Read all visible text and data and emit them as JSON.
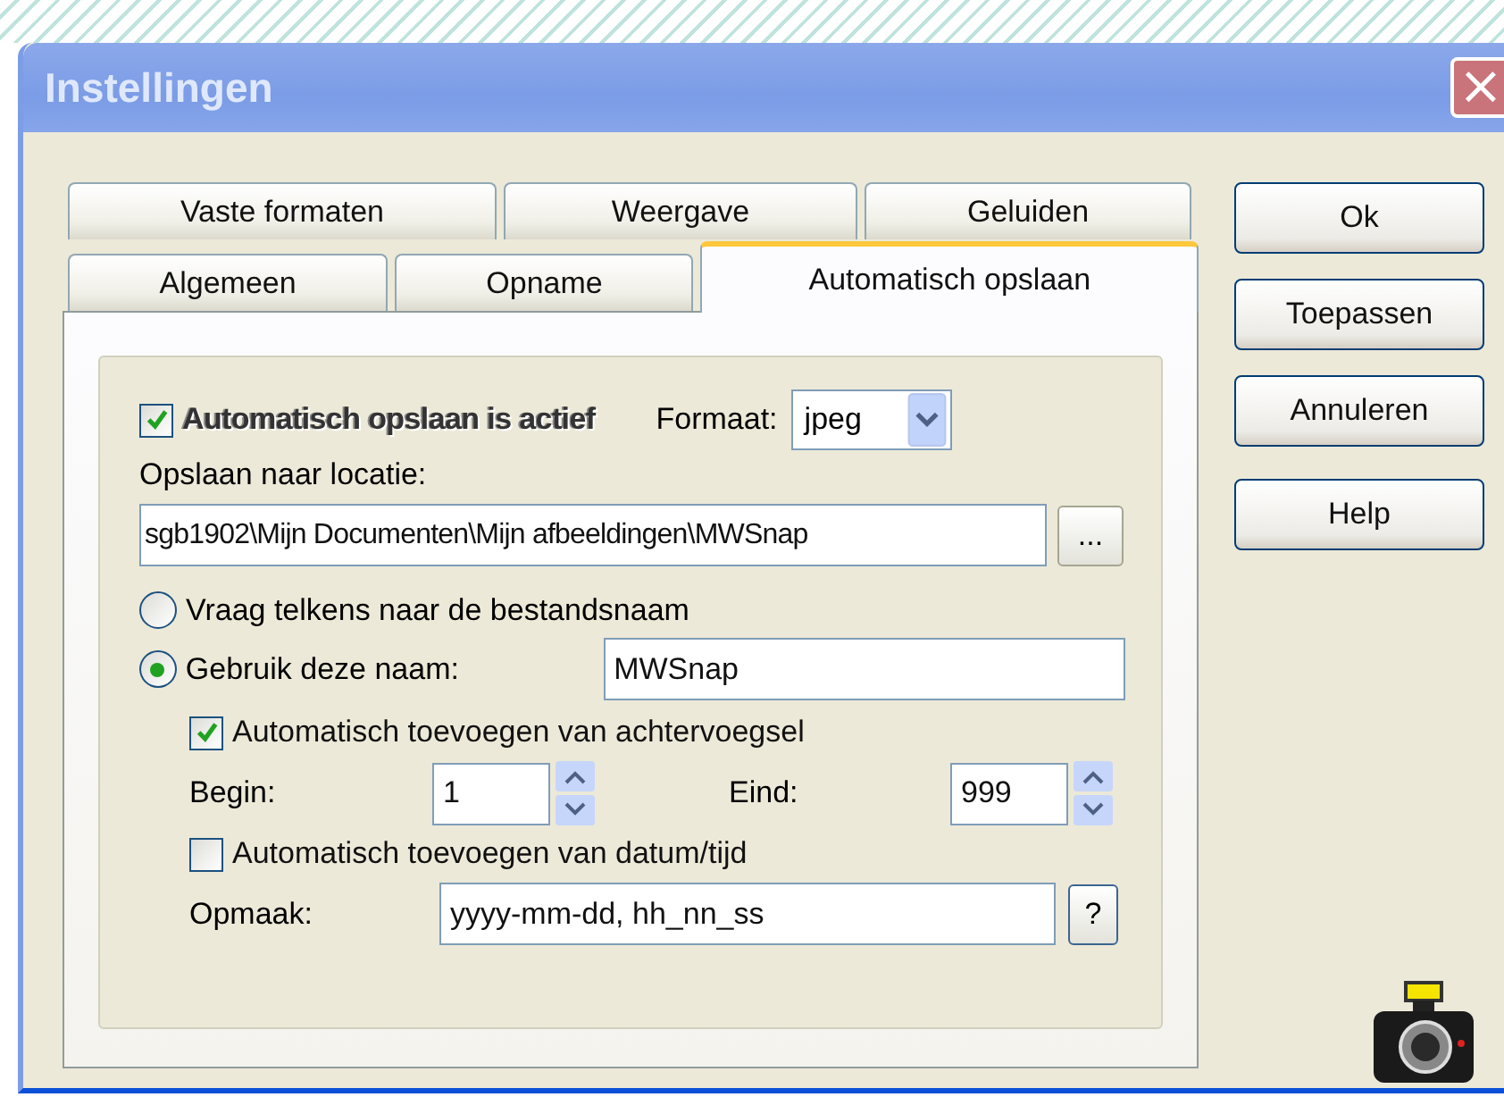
{
  "window": {
    "title": "Instellingen",
    "close": "×"
  },
  "tab_rows": [
    {
      "tabs": [
        {
          "label": "Vaste formaten",
          "selected": false
        },
        {
          "label": "Weergave",
          "selected": false
        },
        {
          "label": "Geluiden",
          "selected": false
        }
      ]
    },
    {
      "tabs": [
        {
          "label": "Algemeen",
          "selected": false
        },
        {
          "label": "Opname",
          "selected": false
        },
        {
          "label": "Automatisch opslaan",
          "selected": true
        }
      ]
    }
  ],
  "auto_save": {
    "enabled": {
      "label": "Automatisch opslaan is actief",
      "checked": true
    },
    "format": {
      "label": "Formaat:",
      "value": "jpeg"
    },
    "location": {
      "label": "Opslaan naar locatie:",
      "value": "sgb1902\\Mijn Documenten\\Mijn afbeeldingen\\MWSnap",
      "browse": "..."
    },
    "naming": [
      {
        "label": "Vraag telkens naar de bestandsnaam",
        "selected": false
      },
      {
        "label": "Gebruik deze naam:",
        "selected": true,
        "value": "MWSnap"
      }
    ],
    "suffix": {
      "label": "Automatisch toevoegen van achtervoegsel",
      "checked": true
    },
    "begin": {
      "label": "Begin:",
      "value": "1"
    },
    "end": {
      "label": "Eind:",
      "value": "999"
    },
    "datetime": {
      "label": "Automatisch toevoegen van datum/tijd",
      "checked": false
    },
    "pattern": {
      "label": "Opmaak:",
      "value": "yyyy-mm-dd, hh_nn_ss",
      "help": "?"
    }
  },
  "buttons": [
    {
      "label": "Ok"
    },
    {
      "label": "Toepassen"
    },
    {
      "label": "Annuleren"
    },
    {
      "label": "Help"
    }
  ]
}
